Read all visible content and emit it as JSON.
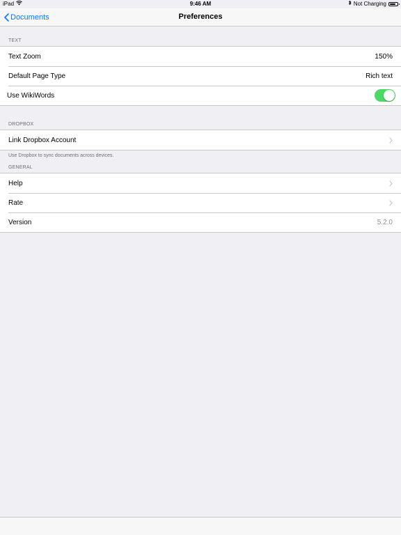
{
  "status_bar": {
    "device": "iPad",
    "time": "9:46 AM",
    "charging": "Not Charging"
  },
  "nav": {
    "back_label": "Documents",
    "title": "Preferences"
  },
  "sections": {
    "text": {
      "header": "TEXT",
      "text_zoom_label": "Text Zoom",
      "text_zoom_value": "150%",
      "page_type_label": "Default Page Type",
      "page_type_value": "Rich text",
      "wikiwords_label": "Use WikiWords",
      "wikiwords_enabled": true
    },
    "dropbox": {
      "header": "DROPBOX",
      "link_label": "Link Dropbox Account",
      "footer": "Use Dropbox to sync documents across devices."
    },
    "general": {
      "header": "GENERAL",
      "help_label": "Help",
      "rate_label": "Rate",
      "version_label": "Version",
      "version_value": "5.2.0"
    }
  },
  "colors": {
    "accent": "#007aff",
    "toggle_on": "#4cd964",
    "background": "#efeff4"
  }
}
